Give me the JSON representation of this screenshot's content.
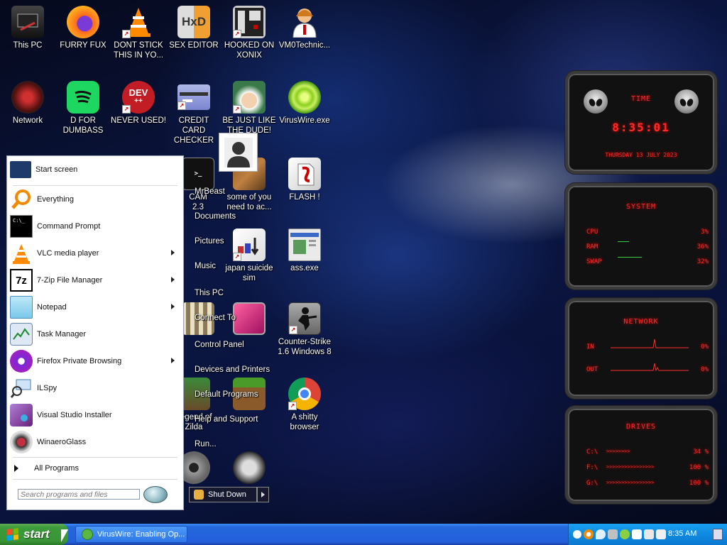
{
  "desktop": {
    "icons": [
      {
        "label": "This PC"
      },
      {
        "label": "FURRY FUX"
      },
      {
        "label": "DONT STICK THIS IN YO..."
      },
      {
        "label": "SEX EDITOR"
      },
      {
        "label": "HOOKED ON XONIX"
      },
      {
        "label": "VM0Technic..."
      },
      {
        "label": "Network"
      },
      {
        "label": "D FOR DUMBASS"
      },
      {
        "label": "NEVER USED!"
      },
      {
        "label": "CREDIT CARD CHECKER"
      },
      {
        "label": "BE JUST LIKE THE DUDE!"
      },
      {
        "label": "VirusWire.exe"
      },
      {
        "label": "some of you need to ac..."
      },
      {
        "label": "FLASH !"
      },
      {
        "label": "japan suicide sim"
      },
      {
        "label": "ass.exe"
      },
      {
        "label": "Counter-Strike 1.6 Windows 8"
      },
      {
        "label": "A shitty browser"
      }
    ],
    "partial_labels": {
      "cam": "CAM",
      "ver": "2.3",
      "leg": "Legend of Zilda"
    },
    "dev_icon_text": "DEV"
  },
  "start_menu": {
    "items": [
      {
        "label": "Start screen"
      },
      {
        "label": "Everything"
      },
      {
        "label": "Command Prompt"
      },
      {
        "label": "VLC media player"
      },
      {
        "label": "7-Zip File Manager"
      },
      {
        "label": "Notepad"
      },
      {
        "label": "Task Manager"
      },
      {
        "label": "Firefox Private Browsing"
      },
      {
        "label": "ILSpy"
      },
      {
        "label": "Visual Studio Installer"
      },
      {
        "label": "WinaeroGlass"
      }
    ],
    "all_programs": "All Programs",
    "search_placeholder": "Search programs and files",
    "right_column": [
      "MrBeast",
      "Documents",
      "Pictures",
      "Music",
      "This PC",
      "Connect To",
      "Control Panel",
      "Devices and Printers",
      "Default Programs",
      "Help and Support",
      "Run..."
    ],
    "shutdown_label": "Shut Down",
    "icon_text": {
      "seven_zip": "7z",
      "cmd": "C:\\_"
    }
  },
  "gadget": {
    "time": {
      "title": "TIME",
      "clock": "8:35:01",
      "date": "THURSDAY 13 JULY 2023"
    },
    "system": {
      "title": "SYSTEM",
      "rows": [
        {
          "label": "CPU",
          "value": "3%"
        },
        {
          "label": "RAM",
          "value": "36%"
        },
        {
          "label": "SWAP",
          "value": "32%"
        }
      ]
    },
    "network": {
      "title": "NETWORK",
      "rows": [
        {
          "label": "IN",
          "value": "0%"
        },
        {
          "label": "OUT",
          "value": "0%"
        }
      ]
    },
    "drives": {
      "title": "DRIVES",
      "rows": [
        {
          "label": "C:\\",
          "bar": ">>>>>>>>",
          "value": "34 %"
        },
        {
          "label": "F:\\",
          "bar": ">>>>>>>>>>>>>>>>",
          "value": "100 %"
        },
        {
          "label": "G:\\",
          "bar": ">>>>>>>>>>>>>>>>",
          "value": "100 %"
        }
      ]
    }
  },
  "taskbar": {
    "start_label": "start",
    "task_item": "VirusWire: Enabling Op...",
    "clock": "8:35 AM"
  },
  "colors": {
    "accent_red": "#ff2a2a",
    "taskbar_blue": "#245edc",
    "start_green": "#3a9636"
  }
}
